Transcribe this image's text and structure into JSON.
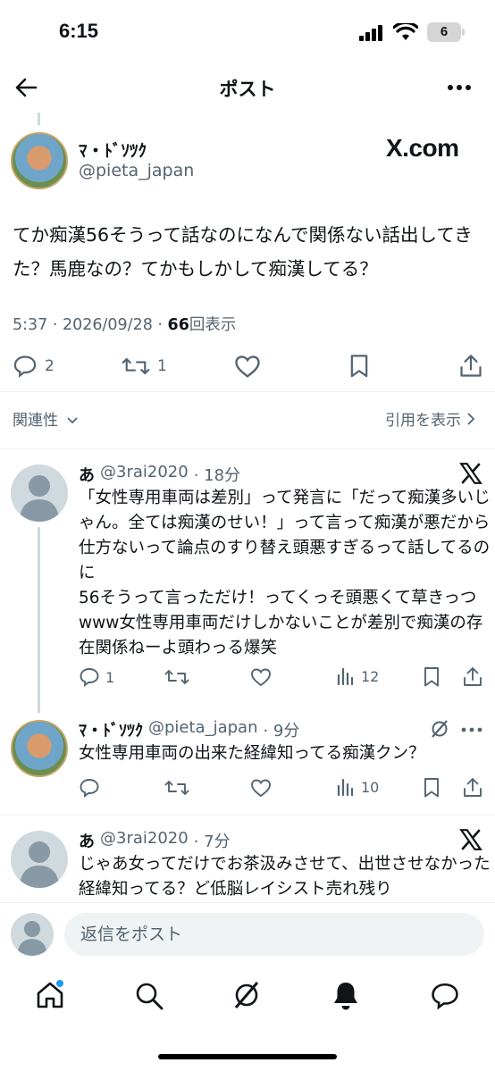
{
  "status_bar": {
    "time": "6:15",
    "battery": "6"
  },
  "nav": {
    "title": "ポスト"
  },
  "tweet": {
    "author_name": "ﾏ・ﾄﾞｿﾂｸ",
    "author_handle": "@pieta_japan",
    "badge": "X.com",
    "text": "てか痴漢56そうって話なのになんで関係ない話出してきた？馬鹿なの？てかもしかして痴漢してる？",
    "time": "5:37 · 2026/09/28 · ",
    "views_count": "66",
    "views_label": "回表示",
    "replies": "2",
    "reposts": "1"
  },
  "related": {
    "label": "関連性",
    "quotes_label": "引用を表示"
  },
  "replies": [
    {
      "name": "あ",
      "handle": "@3rai2020",
      "time": "· 18分",
      "text": "「女性専用車両は差別」って発言に「だって痴漢多いじゃん。全ては痴漢のせい！」って言って痴漢が悪だから仕方ないって論点のすり替え頭悪すぎるって話してるのに\n56そうって言っただけ！ってくっそ頭悪くて草きっつwww女性専用車両だけしかないことが差別で痴漢の存在関係ねーよ頭わっる爆笑",
      "reply_count": "1",
      "views": "12"
    },
    {
      "name": "ﾏ・ﾄﾞｿﾂｸ",
      "handle": "@pieta_japan",
      "time": "· 9分",
      "text": "女性専用車両の出来た経緯知ってる痴漢クン？",
      "views": "10"
    },
    {
      "name": "あ",
      "handle": "@3rai2020",
      "time": "· 7分",
      "text": "じゃあ女ってだけでお茶汲みさせて、出世させなかった経緯知ってる？ど低脳レイシスト売れ残り"
    }
  ],
  "reply_box": {
    "placeholder": "返信をポスト"
  },
  "colors": {
    "accent": "#1d9bf0",
    "text": "#0f1419",
    "secondary": "#536471"
  }
}
